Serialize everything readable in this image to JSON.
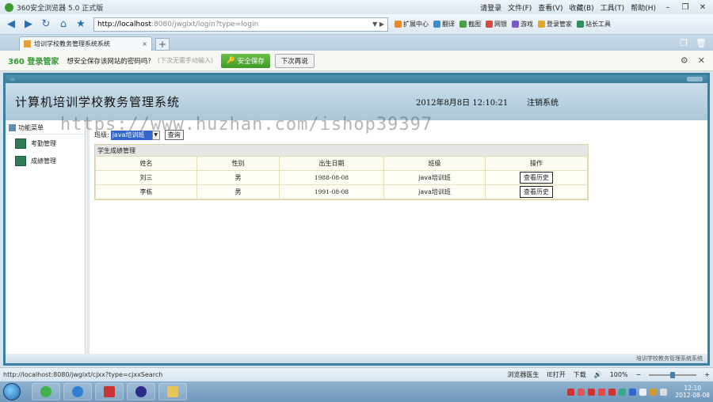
{
  "browser": {
    "title": "360安全浏览器 5.0 正式版",
    "menu": [
      "请登录",
      "文件(F)",
      "查看(V)",
      "收藏(B)",
      "工具(T)",
      "帮助(H)"
    ],
    "address_host": "http://localhost",
    "address_rest": ":8080/jwglxt/login?type=login",
    "tools": [
      "扩展中心",
      "翻译",
      "截图",
      "网银",
      "游戏",
      "登录管家",
      "站长工具"
    ],
    "tab_title": "培训学校教务管理系统系统",
    "password_bar": {
      "brand": "360 登录管家",
      "message": "想安全保存该网站的密码吗？",
      "hint": "(下次无需手动输入)",
      "save_button": "安全保存",
      "later_button": "下次再说"
    },
    "status_url": "http://localhost:8080/jwglxt/cjxx?type=cjxxSearch",
    "status_items": [
      "浏览器医生",
      "IE打开",
      "下载",
      "100%"
    ],
    "clock_time": "12:10",
    "clock_date": "2012-08-08"
  },
  "app": {
    "system_title": "计算机培训学校教务管理系统",
    "datetime": "2012年8月8日  12:10:21",
    "logout": "注销系统",
    "sidebar_header": "功能菜单",
    "sidebar_items": [
      "考勤管理",
      "成绩管理"
    ],
    "filter": {
      "label": "班级:",
      "selected": "java培训班",
      "query_button": "查询"
    },
    "grid": {
      "caption": "学生成绩管理",
      "columns": [
        "姓名",
        "性别",
        "出生日期",
        "班级",
        "操作"
      ],
      "rows": [
        {
          "name": "刘三",
          "gender": "男",
          "birth": "1988-08-08",
          "class": "java培训班",
          "action": "查看历史"
        },
        {
          "name": "李栋",
          "gender": "男",
          "birth": "1991-08-08",
          "class": "java培训班",
          "action": "查看历史"
        }
      ]
    },
    "footer": "培训学校教务管理系统系统"
  },
  "watermark": "https://www.huzhan.com/ishop39397",
  "zoom": 0.5
}
